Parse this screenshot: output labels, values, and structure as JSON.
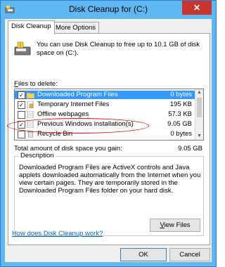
{
  "window": {
    "title": "Disk Cleanup for  (C:)",
    "close_glyph": "✕"
  },
  "tabs": [
    {
      "label": "Disk Cleanup"
    },
    {
      "label": "More Options"
    }
  ],
  "intro_text": "You can use Disk Cleanup to free up to 10.1 GB of disk space on  (C:).",
  "files_label_prefix": "F",
  "files_label_rest": "iles to delete:",
  "files": [
    {
      "name": "Downloaded Program Files",
      "size": "0 bytes",
      "checked": true,
      "selected": true,
      "icon": "folder-icon"
    },
    {
      "name": "Temporary Internet Files",
      "size": "195 KB",
      "checked": true,
      "selected": false,
      "icon": "lock-page-icon"
    },
    {
      "name": "Offline webpages",
      "size": "57.3 KB",
      "checked": false,
      "selected": false,
      "icon": "page-icon"
    },
    {
      "name": "Previous Windows installation(s)",
      "size": "9.05 GB",
      "checked": true,
      "selected": false,
      "icon": "page-icon"
    },
    {
      "name": "Recycle Bin",
      "size": "0 bytes",
      "checked": false,
      "selected": false,
      "icon": "recycle-bin-icon"
    }
  ],
  "total_label": "Total amount of disk space you gain:",
  "total_value": "9.05 GB",
  "description": {
    "title": "Description",
    "text": "Downloaded Program Files are ActiveX controls and Java applets downloaded automatically from the Internet when you view certain pages. They are temporarily stored in the Downloaded Program Files folder on your hard disk."
  },
  "view_files_prefix": "V",
  "view_files_rest": "iew Files",
  "help_link": "How does Disk Cleanup work?",
  "buttons": {
    "ok": "OK",
    "cancel": "Cancel"
  },
  "colors": {
    "title_bar": "#5fb8f2",
    "selection": "#3399ff",
    "highlight_oval": "#dd1111",
    "link": "#0066cc",
    "close": "#c7372f"
  }
}
